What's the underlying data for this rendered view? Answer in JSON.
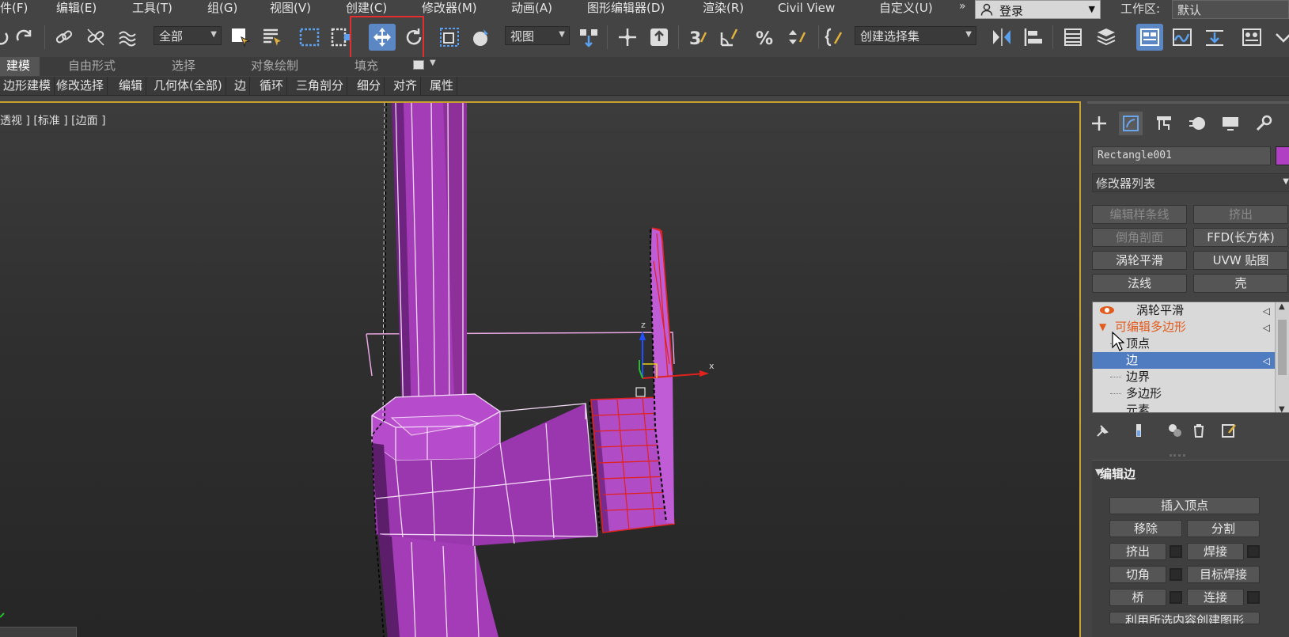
{
  "menu": [
    "件(F)",
    "编辑(E)",
    "工具(T)",
    "组(G)",
    "视图(V)",
    "创建(C)",
    "修改器(M)",
    "动画(A)",
    "图形编辑器(D)",
    "渲染(R)",
    "Civil View",
    "自定义(U)"
  ],
  "more_chevron": "»",
  "login_label": "登录",
  "workspace_label": "工作区:",
  "workspace_value": "默认",
  "toolbar": {
    "filter_dropdown": "全部",
    "coord_dropdown": "视图",
    "selset_dropdown": "创建选择集"
  },
  "ribbon": {
    "tabs": [
      "建模",
      "自由形式",
      "选择",
      "对象绘制",
      "填充"
    ],
    "buttons": [
      "边形建模",
      "修改选择",
      "编辑",
      "几何体(全部)",
      "边",
      "循环",
      "三角剖分",
      "细分",
      "对齐",
      "属性"
    ]
  },
  "viewport": {
    "label": "透视 ] [标准 ] [边面 ]",
    "axes": {
      "z": "z",
      "x": "x"
    }
  },
  "panel": {
    "object_name": "Rectangle001",
    "object_color": "#b03fc4",
    "modifier_list": "修改器列表",
    "mod_buttons": [
      {
        "label": "编辑样条线",
        "dim": true
      },
      {
        "label": "挤出",
        "dim": true
      },
      {
        "label": "倒角剖面",
        "dim": true
      },
      {
        "label": "FFD(长方体)",
        "dim": false
      },
      {
        "label": "涡轮平滑",
        "dim": false
      },
      {
        "label": "UVW 贴图",
        "dim": false
      },
      {
        "label": "法线",
        "dim": false
      },
      {
        "label": "壳",
        "dim": false
      }
    ],
    "stack": [
      {
        "label": "涡轮平滑"
      },
      {
        "label": "可编辑多边形"
      },
      {
        "label": "顶点"
      },
      {
        "label": "边"
      },
      {
        "label": "边界"
      },
      {
        "label": "多边形"
      },
      {
        "label": "元素"
      }
    ],
    "rollout_title": "编辑边",
    "edit_buttons": {
      "insert_vertex": "插入顶点",
      "remove": "移除",
      "split": "分割",
      "extrude": "挤出",
      "weld": "焊接",
      "chamfer": "切角",
      "target_weld": "目标焊接",
      "bridge": "桥",
      "connect": "连接",
      "create_shape": "利用所选内容创建图形"
    }
  }
}
